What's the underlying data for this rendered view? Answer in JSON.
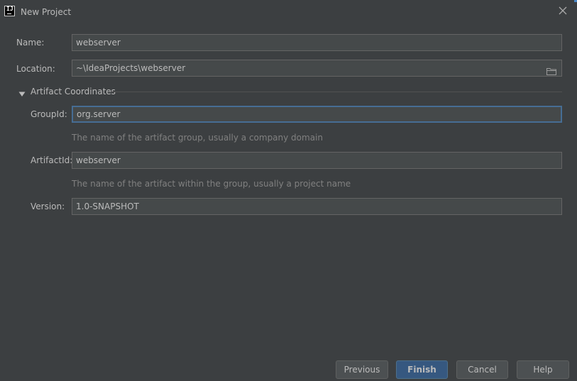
{
  "window": {
    "title": "New Project",
    "app_icon_text": "IJ"
  },
  "form": {
    "name": {
      "label": "Name:",
      "value": "webserver"
    },
    "location": {
      "label": "Location:",
      "value": "~\\IdeaProjects\\webserver"
    },
    "artifact_section": {
      "label": "Artifact Coordinates",
      "expanded": true
    },
    "group_id": {
      "label": "GroupId:",
      "value": "org.server",
      "hint": "The name of the artifact group, usually a company domain"
    },
    "artifact_id": {
      "label": "ArtifactId:",
      "value": "webserver",
      "hint": "The name of the artifact within the group, usually a project name"
    },
    "version": {
      "label": "Version:",
      "value": "1.0-SNAPSHOT"
    }
  },
  "buttons": {
    "previous": "Previous",
    "finish": "Finish",
    "cancel": "Cancel",
    "help": "Help"
  },
  "colors": {
    "background": "#3c3f41",
    "field_background": "#45494a",
    "focus_border": "#466d94",
    "primary_button": "#365880",
    "text": "#bbbbbb",
    "hint_text": "#808080"
  },
  "icons": {
    "app": "intellij-icon",
    "close": "close-icon",
    "browse": "folder-icon",
    "expand": "triangle-down-icon"
  }
}
